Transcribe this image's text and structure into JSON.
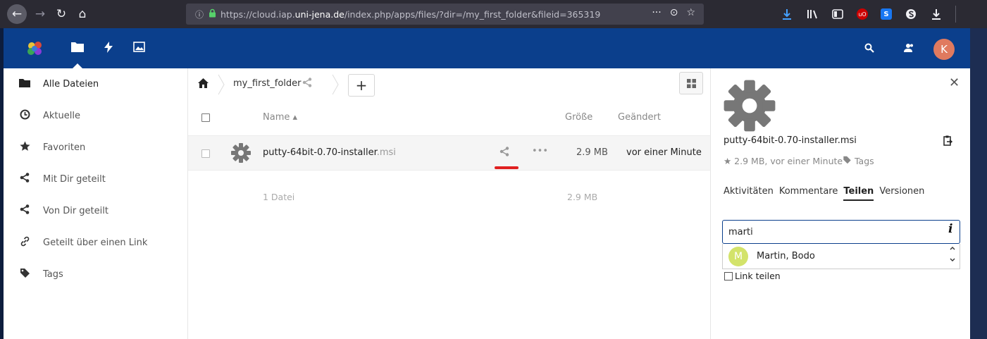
{
  "browser": {
    "url_prefix": "https://cloud.iap.",
    "url_domain": "uni-jena.de",
    "url_suffix": "/index.php/apps/files/?dir=/my_first_folder&fileid=365319",
    "info_glyph": "ⓘ",
    "url_more": "···",
    "pocket_glyph": "⊙",
    "star_glyph": "☆"
  },
  "nc_header": {
    "avatar_initial": "K"
  },
  "sidebar": {
    "items": [
      {
        "label": "Alle Dateien",
        "icon": "folder-icon"
      },
      {
        "label": "Aktuelle",
        "icon": "clock-icon"
      },
      {
        "label": "Favoriten",
        "icon": "star-icon"
      },
      {
        "label": "Mit Dir geteilt",
        "icon": "share-icon"
      },
      {
        "label": "Von Dir geteilt",
        "icon": "share-icon"
      },
      {
        "label": "Geteilt über einen Link",
        "icon": "link-icon"
      },
      {
        "label": "Tags",
        "icon": "tag-icon"
      }
    ]
  },
  "breadcrumb": {
    "folder": "my_first_folder",
    "add": "+"
  },
  "table": {
    "col_name": "Name ▴",
    "col_size": "Größe",
    "col_modified": "Geändert",
    "rows": [
      {
        "name": "putty-64bit-0.70-installer",
        "ext": ".msi",
        "more": "•••",
        "size": "2.9 MB",
        "modified": "vor einer Minute"
      }
    ],
    "summary_count": "1 Datei",
    "summary_size": "2.9 MB"
  },
  "details": {
    "file_name": "putty-64bit-0.70-installer.msi",
    "meta": "★ 2.9 MB, vor einer Minute",
    "tags": "Tags",
    "tabs": [
      "Aktivitäten",
      "Kommentare",
      "Teilen",
      "Versionen"
    ],
    "active_tab": "Teilen",
    "share_input_value": "marti",
    "share_info_glyph": "i",
    "suggestion_initial": "M",
    "suggestion_name": "Martin, Bodo",
    "link_share_label": "Link teilen",
    "close_glyph": "✕"
  },
  "colors": {
    "header_blue": "#0b3f8c",
    "share_underline": "#e02020",
    "avatar": "#e07a5f",
    "suggestion_avatar": "#d3e36a"
  }
}
